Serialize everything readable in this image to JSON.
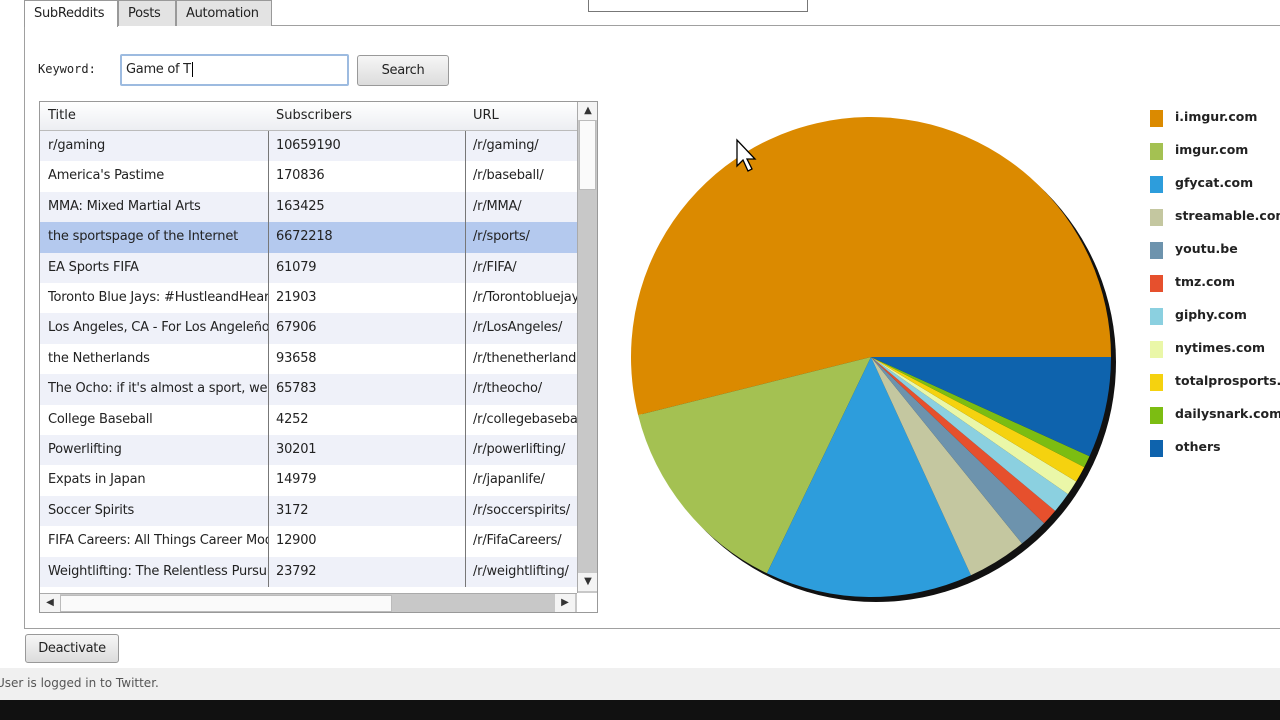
{
  "tabs": [
    {
      "label": "SubReddits",
      "active": true
    },
    {
      "label": "Posts"
    },
    {
      "label": "Automation"
    }
  ],
  "search": {
    "label": "Keyword:",
    "value": "Game of T",
    "button": "Search"
  },
  "table": {
    "columns": [
      "Title",
      "Subscribers",
      "URL"
    ],
    "selected_index": 3,
    "rows": [
      [
        "r/gaming",
        "10659190",
        "/r/gaming/"
      ],
      [
        "America's Pastime",
        "170836",
        "/r/baseball/"
      ],
      [
        "MMA: Mixed Martial Arts",
        "163425",
        "/r/MMA/"
      ],
      [
        "the sportspage of the Internet",
        "6672218",
        "/r/sports/"
      ],
      [
        "EA Sports FIFA",
        "61079",
        "/r/FIFA/"
      ],
      [
        "Toronto Blue Jays: #HustleandHeart",
        "21903",
        "/r/Torontobluejays/"
      ],
      [
        "Los Angeles, CA - For Los Angeleños",
        "67906",
        "/r/LosAngeles/"
      ],
      [
        "the Netherlands",
        "93658",
        "/r/thenetherlands/"
      ],
      [
        "The Ocho: if it's almost a sport, we",
        "65783",
        "/r/theocho/"
      ],
      [
        "College Baseball",
        "4252",
        "/r/collegebaseball/"
      ],
      [
        "Powerlifting",
        "30201",
        "/r/powerlifting/"
      ],
      [
        "Expats in Japan",
        "14979",
        "/r/japanlife/"
      ],
      [
        "Soccer Spirits",
        "3172",
        "/r/soccerspirits/"
      ],
      [
        "FIFA Careers: All Things Career Mode",
        "12900",
        "/r/FifaCareers/"
      ],
      [
        "Weightlifting: The Relentless Pursuit",
        "23792",
        "/r/weightlifting/"
      ]
    ]
  },
  "deactivate_label": "Deactivate",
  "status": "User is logged in to Twitter.",
  "chart_data": {
    "type": "pie",
    "legend_position": "right",
    "categories": [
      "i.imgur.com",
      "imgur.com",
      "gfycat.com",
      "streamable.com",
      "youtu.be",
      "tmz.com",
      "giphy.com",
      "nytimes.com",
      "totalprosports.com",
      "dailysnark.com",
      "others"
    ],
    "values": [
      54,
      14,
      14,
      4,
      2,
      1.1,
      1.4,
      1,
      1.1,
      0.8,
      6.8
    ],
    "colors": [
      "#db8a00",
      "#a4c152",
      "#2d9ddc",
      "#c4c7a0",
      "#6d93ad",
      "#e6502d",
      "#8bd0e0",
      "#eaf7a8",
      "#f5d20f",
      "#7cbd12",
      "#0e63ad"
    ]
  }
}
